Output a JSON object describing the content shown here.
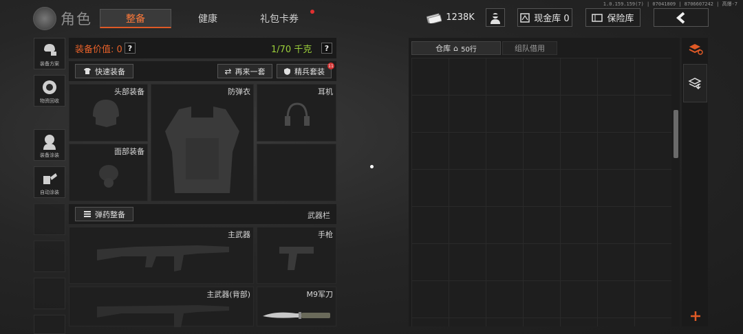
{
  "version": "1.0.159.159(7) | 07041809 | 8706607242 | 高爆-7",
  "header": {
    "title": "角色",
    "tabs": [
      {
        "label": "整备",
        "active": true
      },
      {
        "label": "健康",
        "active": false
      },
      {
        "label": "礼包卡券",
        "active": false,
        "badge": true
      }
    ],
    "money": "1238K",
    "cash_vault": "现金库 0",
    "safe_box": "保险库"
  },
  "left_menu": [
    {
      "label": "装备方案",
      "icon": "loadout-icon"
    },
    {
      "label": "物资回收",
      "icon": "recycle-icon"
    },
    {
      "label": "装备涂装",
      "icon": "skin-icon"
    },
    {
      "label": "自动涂装",
      "icon": "auto-paint-icon"
    }
  ],
  "equipment": {
    "value_label": "装备价值: 0",
    "help": "?",
    "weight": "1/70 千克",
    "quick_equip": "快速装备",
    "again": "再来一套",
    "elite_set": "精兵套装",
    "elite_badge": "11",
    "slots": {
      "head": "头部装备",
      "armor": "防弹衣",
      "earphone": "耳机",
      "face": "面部装备"
    },
    "ammo_equip": "弹药整备",
    "weapon_bar": "武器栏",
    "weapons": {
      "primary": "主武器",
      "pistol": "手枪",
      "primary_back": "主武器(背部)",
      "knife": "M9军刀"
    }
  },
  "inventory": {
    "tab_warehouse": "仓库",
    "rows": "50行",
    "tab_team": "组队借用"
  },
  "colors": {
    "accent": "#e05a26",
    "weight_green": "#9cd03a"
  }
}
